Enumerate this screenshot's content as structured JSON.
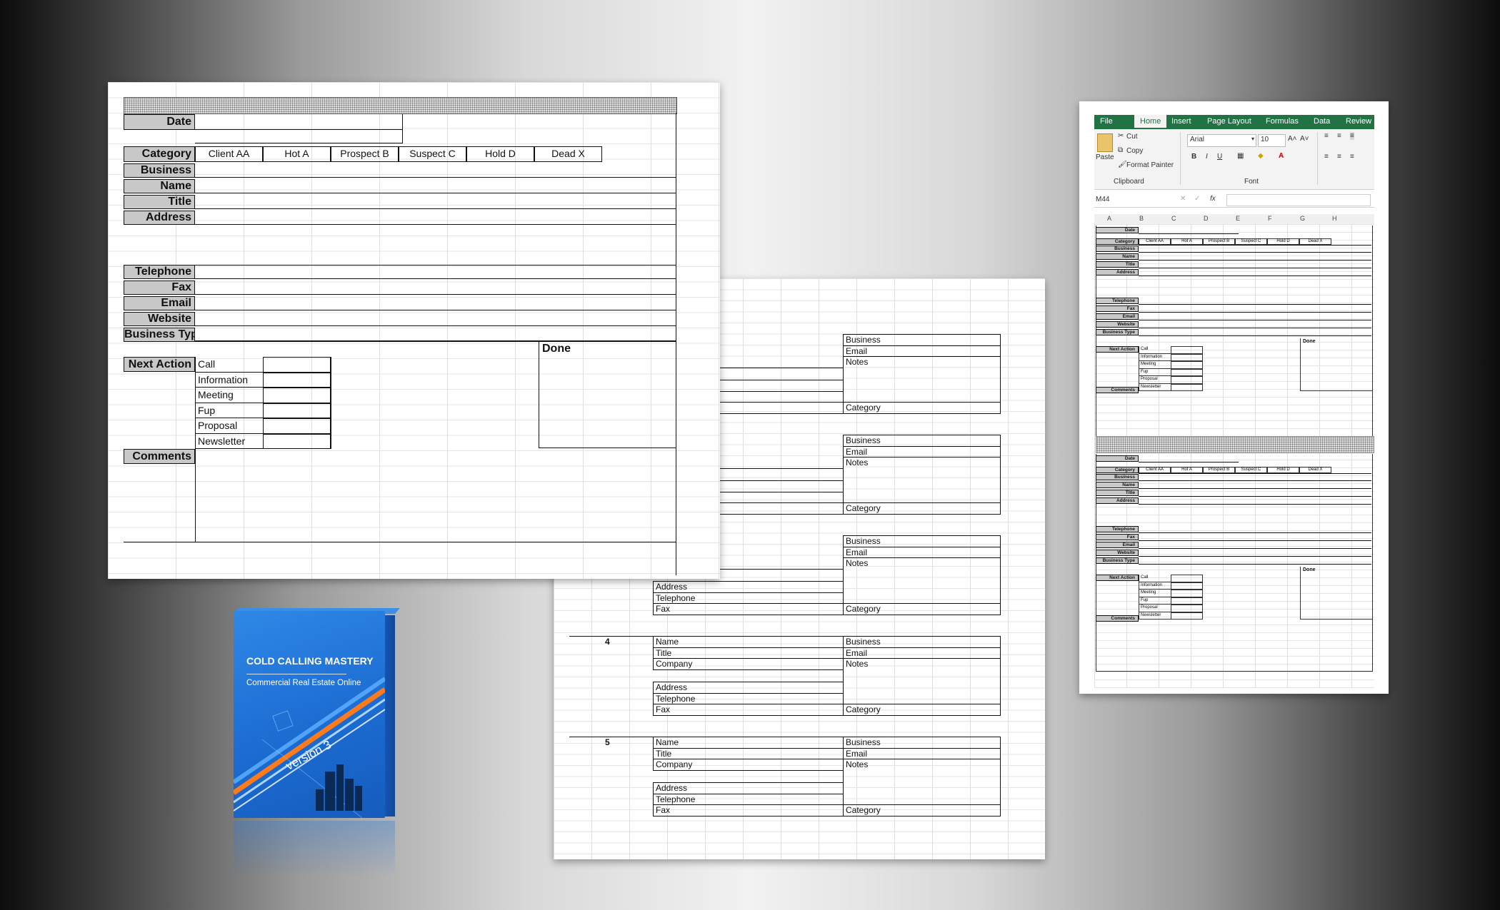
{
  "main_form": {
    "labels": {
      "date": "Date",
      "category": "Category",
      "business": "Business",
      "name": "Name",
      "title": "Title",
      "address": "Address",
      "telephone": "Telephone",
      "fax": "Fax",
      "email": "Email",
      "website": "Website",
      "business_type": "Business Type",
      "next_action": "Next Action",
      "comments": "Comments",
      "done": "Done"
    },
    "categories": [
      "Client AA",
      "Hot A",
      "Prospect B",
      "Suspect C",
      "Hold D",
      "Dead X"
    ],
    "actions": [
      "Call",
      "Information",
      "Meeting",
      "Fup",
      "Proposal",
      "Newsletter"
    ]
  },
  "list_form": {
    "left_fields": [
      "Name",
      "Title",
      "Company",
      "Address",
      "Telephone",
      "Fax"
    ],
    "right_fields": [
      "Business",
      "Email",
      "Notes",
      "Category"
    ],
    "record_numbers": [
      "4",
      "5"
    ]
  },
  "product_box": {
    "title": "COLD CALLING MASTERY",
    "subtitle": "Commercial Real Estate Online",
    "version": "version 3"
  },
  "excel": {
    "tabs": [
      "File",
      "Home",
      "Insert",
      "Page Layout",
      "Formulas",
      "Data",
      "Review"
    ],
    "clipboard": {
      "paste": "Paste",
      "cut": "Cut",
      "copy": "Copy",
      "format_painter": "Format Painter",
      "group_label": "Clipboard"
    },
    "font": {
      "name": "Arial",
      "size": "10",
      "group_label": "Font",
      "bold": "B",
      "italic": "I",
      "underline": "U"
    },
    "name_box": "M44",
    "fx": "fx",
    "columns": [
      "A",
      "B",
      "C",
      "D",
      "E",
      "F",
      "G",
      "H"
    ]
  },
  "colors": {
    "excel_green": "#217346",
    "box_blue": "#1c6cd2",
    "label_gray": "#c8c8c8"
  }
}
